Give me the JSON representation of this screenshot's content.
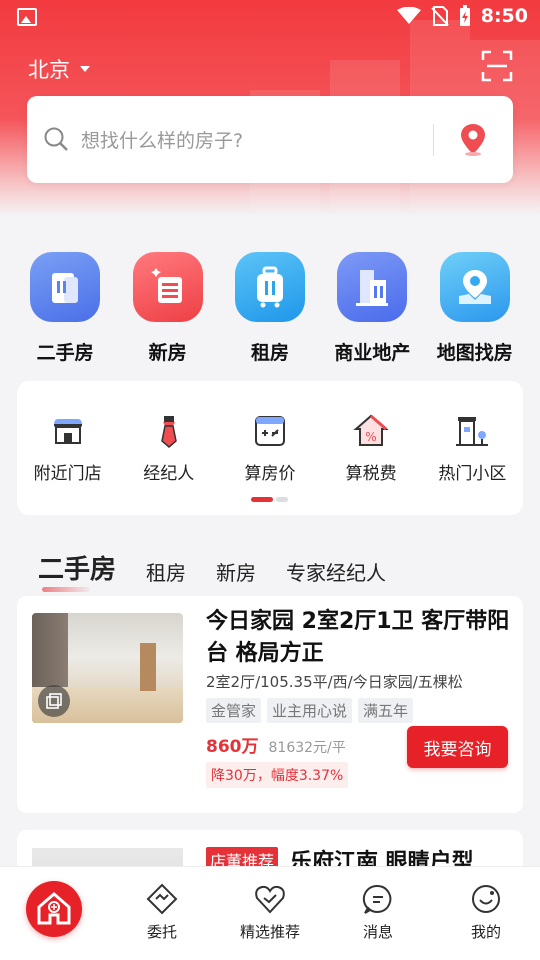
{
  "status": {
    "time": "8:50"
  },
  "header": {
    "city": "北京",
    "search_placeholder": "想找什么样的房子?"
  },
  "categories": [
    {
      "label": "二手房",
      "icon": "building-icon",
      "color": "#5b84ef"
    },
    {
      "label": "新房",
      "icon": "new-house-icon",
      "color": "#f04d52"
    },
    {
      "label": "租房",
      "icon": "luggage-icon",
      "color": "#2aa5ee"
    },
    {
      "label": "商业地产",
      "icon": "office-tower-icon",
      "color": "#5479f1"
    },
    {
      "label": "地图找房",
      "icon": "map-pin-icon",
      "color": "#35a8f2"
    }
  ],
  "tools": [
    {
      "label": "附近门店",
      "icon": "store-icon"
    },
    {
      "label": "经纪人",
      "icon": "agent-tie-icon"
    },
    {
      "label": "算房价",
      "icon": "calculator-icon"
    },
    {
      "label": "算税费",
      "icon": "tax-house-icon"
    },
    {
      "label": "热门小区",
      "icon": "community-icon"
    }
  ],
  "tabs": [
    "二手房",
    "租房",
    "新房",
    "专家经纪人"
  ],
  "listing": {
    "title": "今日家园 2室2厅1卫 客厅带阳台 格局方正",
    "subtitle": "2室2厅/105.35平/西/今日家园/五棵松",
    "tags": [
      "金管家",
      "业主用心说",
      "满五年"
    ],
    "price_total": "860万",
    "price_unit": "81632元/平",
    "price_drop": "降30万，幅度3.37%",
    "consult_label": "我要咨询"
  },
  "listing2": {
    "badge": "店董推荐",
    "title": "乐府江南 眼睛户型"
  },
  "bottom_nav": [
    {
      "label": "委托",
      "icon": "handshake-icon"
    },
    {
      "label": "精选推荐",
      "icon": "heart-check-icon"
    },
    {
      "label": "消息",
      "icon": "message-icon"
    },
    {
      "label": "我的",
      "icon": "smile-icon"
    }
  ],
  "colors": {
    "brand_red": "#e62127",
    "header_red": "#f23a3f"
  }
}
